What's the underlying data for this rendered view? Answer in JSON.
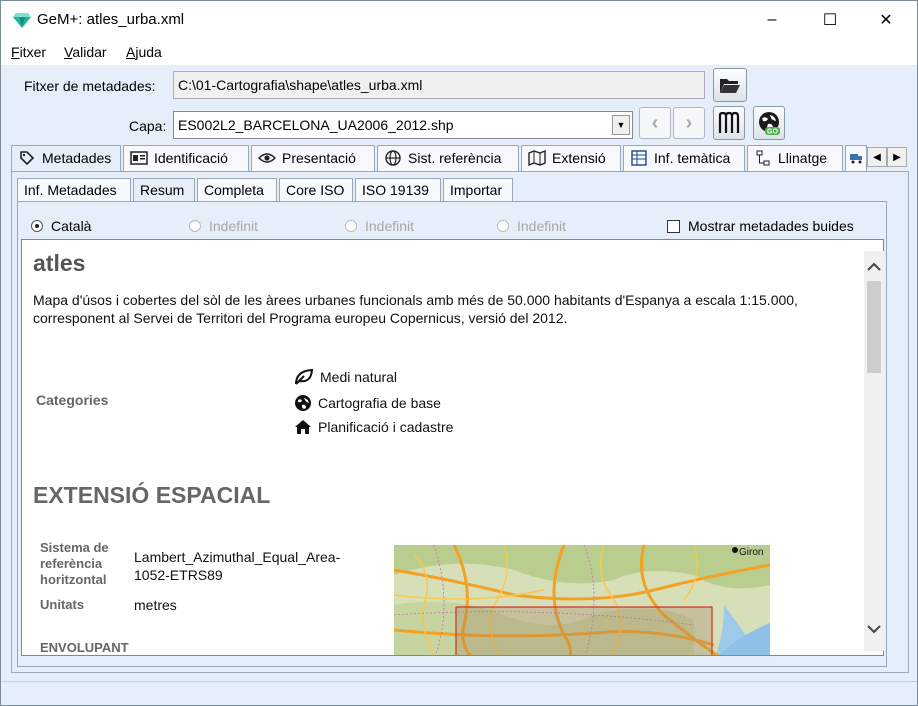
{
  "window": {
    "title": "GeM+: atles_urba.xml",
    "minimize": "–",
    "maximize": "☐",
    "close": "✕"
  },
  "menu": [
    {
      "accel": "F",
      "rest": "itxer"
    },
    {
      "accel": "V",
      "rest": "alidar"
    },
    {
      "accel": "A",
      "rest": "juda"
    }
  ],
  "file": {
    "label": "Fitxer de metadades:",
    "path": "C:\\01-Cartografia\\shape\\atles_urba.xml",
    "open_icon": "folder-open-icon"
  },
  "layer": {
    "label": "Capa:",
    "value": "ES002L2_BARCELONA_UA2006_2012.shp"
  },
  "tabs": [
    {
      "label": "Metadades",
      "icon": "tag-icon",
      "active": true
    },
    {
      "label": "Identificació",
      "icon": "card-icon"
    },
    {
      "label": "Presentació",
      "icon": "eye-icon"
    },
    {
      "label": "Sist. referència",
      "icon": "globe-icon"
    },
    {
      "label": "Extensió",
      "icon": "map-icon"
    },
    {
      "label": "Inf. temàtica",
      "icon": "table-icon"
    },
    {
      "label": "Llinatge",
      "icon": "tree-icon"
    }
  ],
  "subtabs": [
    "Inf. Metadades",
    "Resum",
    "Completa",
    "Core ISO",
    "ISO 19139",
    "Importar"
  ],
  "languages": [
    {
      "label": "Català",
      "enabled": true,
      "selected": true
    },
    {
      "label": "Indefinit",
      "enabled": false
    },
    {
      "label": "Indefinit",
      "enabled": false
    },
    {
      "label": "Indefinit",
      "enabled": false
    }
  ],
  "show_empty": {
    "label": "Mostrar metadades buides",
    "checked": false
  },
  "summary": {
    "title": "atles",
    "abstract": "Mapa d'úsos i cobertes del sòl de les àrees urbanes funcionals amb més de 50.000 habitants d'Espanya a escala 1:15.000, corresponent al Servei de Territori del Programa europeu Copernicus, versió del 2012.",
    "categories_label": "Categories",
    "categories": [
      "Medi natural",
      "Cartografia de base",
      "Planificació i cadastre"
    ],
    "spatial_heading": "EXTENSIÓ ESPACIAL",
    "srs_label": "Sistema de referència horitzontal",
    "srs_value": "Lambert_Azimuthal_Equal_Area-1052-ETRS89",
    "units_label": "Unitats",
    "units_value": "metres",
    "envelope_label": "ENVOLUPANT",
    "map_city": "Giron"
  }
}
